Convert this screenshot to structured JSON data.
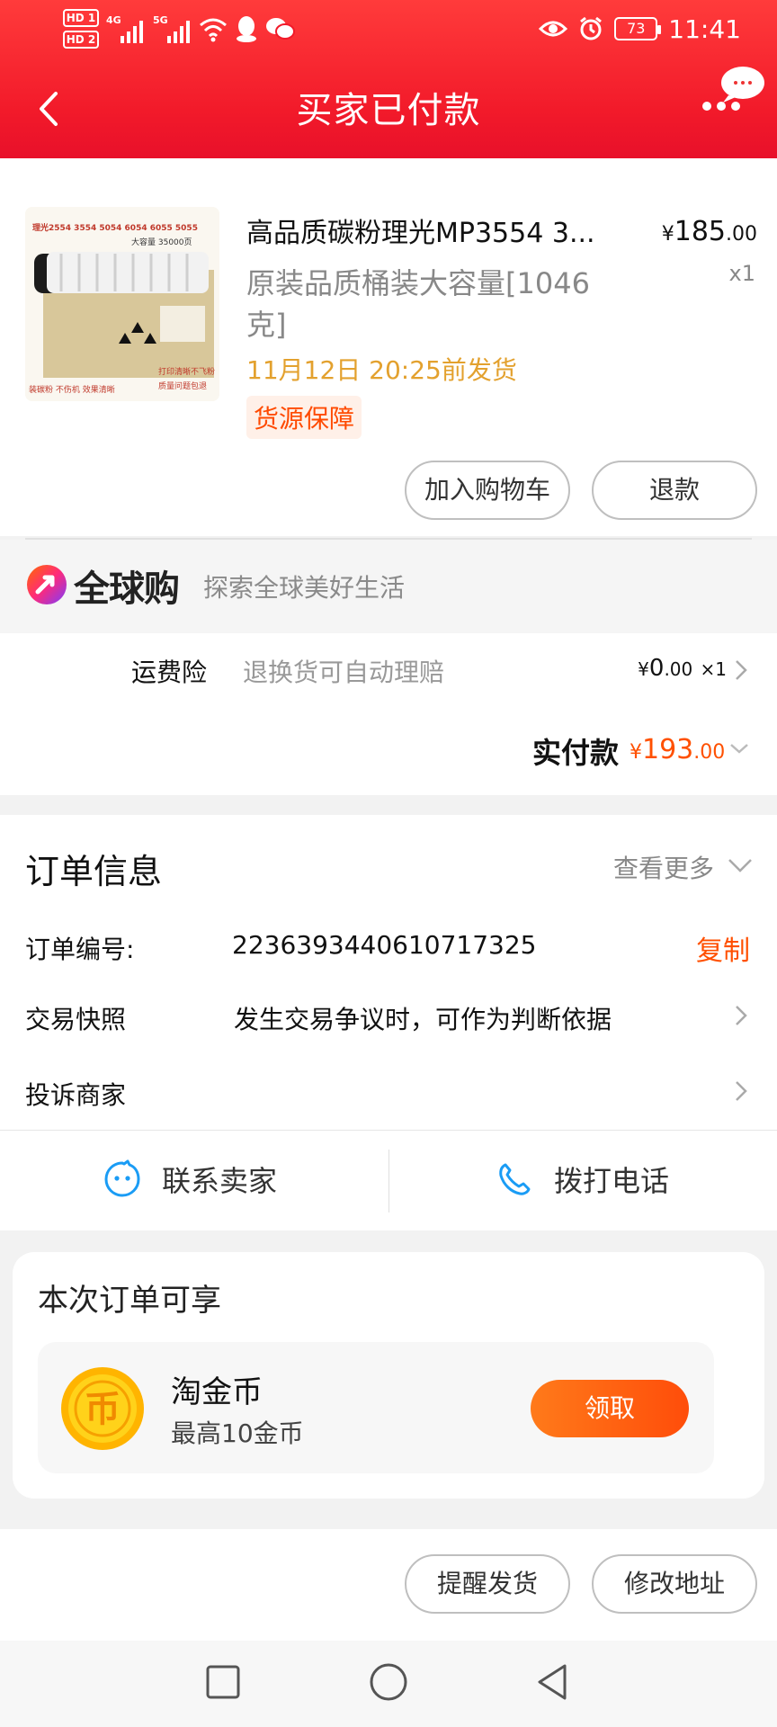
{
  "status_bar": {
    "hd1": "HD 1",
    "hd2": "HD 2",
    "net1": "4G",
    "net2": "5G",
    "battery": "73",
    "time": "11:41"
  },
  "header": {
    "title": "买家已付款"
  },
  "product": {
    "title": "高品质碳粉理光MP3554 3...",
    "sku": "原装品质桶装大容量[1046克]",
    "ship_time": "11月12日 20:25前发货",
    "badge": "货源保障",
    "price_currency": "¥",
    "price_int": "185",
    "price_dec": ".00",
    "qty": "x1",
    "thumb_text_top": "理光2554 3554 5054 6054 6055 5055",
    "thumb_text_cap": "大容量 35000页",
    "thumb_text_bottom1": "装碳粉 不伤机 效果清晰",
    "thumb_text_bottom2": "打印清晰不飞粉",
    "thumb_text_bottom3": "质量问题包退",
    "add_cart_label": "加入购物车",
    "refund_label": "退款"
  },
  "global_buy": {
    "logo_text": "全球购",
    "slogan": "探索全球美好生活"
  },
  "shipping_insurance": {
    "label": "运费险",
    "desc": "退换货可自动理赔",
    "currency": "¥",
    "int": "0",
    "dec": ".00",
    "qty": "×1"
  },
  "payment": {
    "label": "实付款",
    "currency": "¥",
    "int": "193",
    "dec": ".00"
  },
  "order_info": {
    "title": "订单信息",
    "view_more": "查看更多",
    "order_no_label": "订单编号:",
    "order_no": "2236393440610717325",
    "copy_label": "复制",
    "snapshot_label": "交易快照",
    "snapshot_desc": "发生交易争议时，可作为判断依据",
    "complaint_label": "投诉商家"
  },
  "contact": {
    "seller_label": "联系卖家",
    "phone_label": "拨打电话"
  },
  "benefits": {
    "title": "本次订单可享",
    "coin_name": "淘金币",
    "coin_desc": "最高10金币",
    "coin_glyph": "币",
    "claim_label": "领取"
  },
  "bottom_actions": {
    "remind_label": "提醒发货",
    "change_addr_label": "修改地址"
  },
  "colors": {
    "header_red": "#f21a2a",
    "accent_orange": "#ff5000",
    "ship_time_gold": "#e3a12e"
  }
}
